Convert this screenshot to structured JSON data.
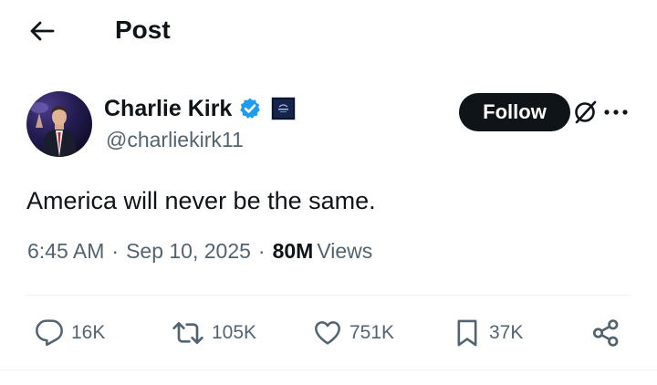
{
  "header": {
    "back_icon": "arrow-left-icon",
    "title": "Post"
  },
  "author": {
    "display_name": "Charlie Kirk",
    "handle": "@charliekirk11",
    "verified_icon": "verified-badge-icon",
    "verified_color": "#1d9bf0",
    "affiliate_icon": "affiliate-badge-icon"
  },
  "follow": {
    "label": "Follow",
    "background": "#0f1419"
  },
  "post": {
    "text": "America will never be the same.",
    "time": "6:45 AM",
    "date": "Sep 10, 2025",
    "views_count": "80M",
    "views_label": "Views"
  },
  "actions": {
    "reply": {
      "icon": "reply-icon",
      "count": "16K"
    },
    "repost": {
      "icon": "repost-icon",
      "count": "105K"
    },
    "like": {
      "icon": "heart-icon",
      "count": "751K"
    },
    "bookmark": {
      "icon": "bookmark-icon",
      "count": "37K"
    },
    "share": {
      "icon": "share-icon"
    }
  },
  "colors": {
    "primary_text": "#0f1419",
    "secondary_text": "#536471",
    "divider": "#eff3f4"
  }
}
